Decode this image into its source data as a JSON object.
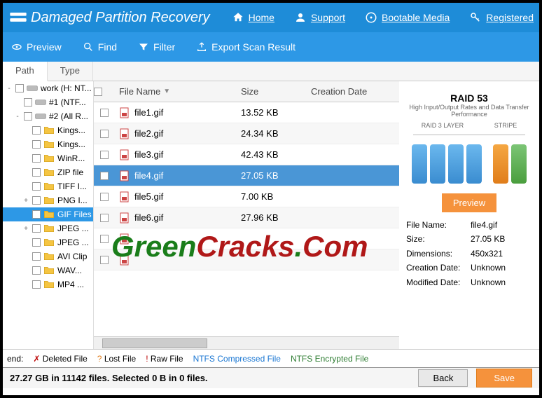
{
  "header": {
    "title": "Damaged Partition Recovery",
    "links": [
      {
        "label": "Home",
        "icon": "home"
      },
      {
        "label": "Support",
        "icon": "support"
      },
      {
        "label": "Bootable Media",
        "icon": "disc"
      },
      {
        "label": "Registered",
        "icon": "key"
      }
    ]
  },
  "toolbar": [
    {
      "label": "Preview",
      "icon": "eye"
    },
    {
      "label": "Find",
      "icon": "search"
    },
    {
      "label": "Filter",
      "icon": "filter"
    },
    {
      "label": "Export Scan Result",
      "icon": "export"
    }
  ],
  "tabs": {
    "active": "Path",
    "other": "Type"
  },
  "tree": [
    {
      "label": "work (H: NT...",
      "level": 1,
      "icon": "drive",
      "expand": "-"
    },
    {
      "label": "#1 (NTF...",
      "level": 2,
      "icon": "drive",
      "expand": ""
    },
    {
      "label": "#2 (All R...",
      "level": 2,
      "icon": "drive",
      "expand": "-"
    },
    {
      "label": "Kings...",
      "level": 3,
      "icon": "folder",
      "expand": ""
    },
    {
      "label": "Kings...",
      "level": 3,
      "icon": "folder",
      "expand": ""
    },
    {
      "label": "WinR...",
      "level": 3,
      "icon": "folder",
      "expand": ""
    },
    {
      "label": "ZIP file",
      "level": 3,
      "icon": "folder",
      "expand": ""
    },
    {
      "label": "TIFF I...",
      "level": 3,
      "icon": "folder",
      "expand": ""
    },
    {
      "label": "PNG I...",
      "level": 3,
      "icon": "folder",
      "expand": "+"
    },
    {
      "label": "GIF Files",
      "level": 3,
      "icon": "folder",
      "expand": "",
      "selected": true
    },
    {
      "label": "JPEG ...",
      "level": 3,
      "icon": "folder",
      "expand": "+"
    },
    {
      "label": "JPEG ...",
      "level": 3,
      "icon": "folder",
      "expand": ""
    },
    {
      "label": "AVI Clip",
      "level": 3,
      "icon": "folder",
      "expand": ""
    },
    {
      "label": "WAV...",
      "level": 3,
      "icon": "folder",
      "expand": ""
    },
    {
      "label": "MP4 ...",
      "level": 3,
      "icon": "folder",
      "expand": ""
    }
  ],
  "columns": {
    "name": "File Name",
    "size": "Size",
    "date": "Creation Date"
  },
  "files": [
    {
      "name": "file1.gif",
      "size": "13.52 KB"
    },
    {
      "name": "file2.gif",
      "size": "24.34 KB"
    },
    {
      "name": "file3.gif",
      "size": "42.43 KB"
    },
    {
      "name": "file4.gif",
      "size": "27.05 KB",
      "selected": true
    },
    {
      "name": "file5.gif",
      "size": "7.00 KB"
    },
    {
      "name": "file6.gif",
      "size": "27.96 KB"
    },
    {
      "name": "",
      "size": ""
    },
    {
      "name": "",
      "size": ""
    }
  ],
  "preview": {
    "title": "RAID 53",
    "subtitle": "High Input/Output Rates and Data Transfer Performance",
    "layer1": "RAID 3 LAYER",
    "layer2": "STRIPE",
    "button": "Preview",
    "meta": [
      {
        "label": "File Name:",
        "value": "file4.gif"
      },
      {
        "label": "Size:",
        "value": "27.05 KB"
      },
      {
        "label": "Dimensions:",
        "value": "450x321"
      },
      {
        "label": "Creation Date:",
        "value": "Unknown"
      },
      {
        "label": "Modified Date:",
        "value": "Unknown"
      }
    ]
  },
  "legend": {
    "end": "end:",
    "deleted": "Deleted File",
    "lost": "Lost File",
    "raw": "Raw File",
    "ntfs1": "NTFS Compressed File",
    "ntfs2": "NTFS Encrypted File"
  },
  "status": {
    "text": " 27.27 GB in 11142 files. Selected 0 B in 0 files.",
    "back": "Back",
    "save": "Save"
  },
  "watermark": "GreenCracks.Com"
}
